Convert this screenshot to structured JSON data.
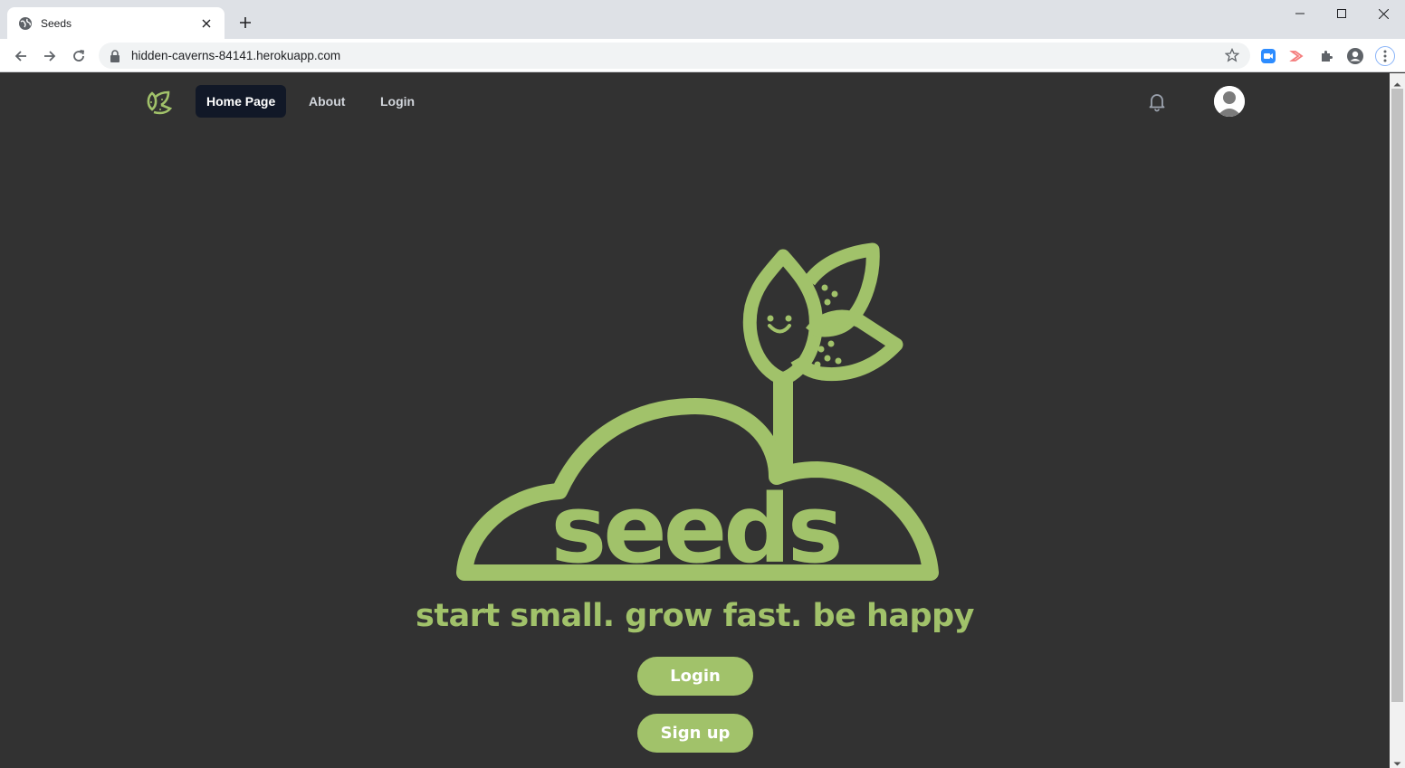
{
  "browser": {
    "tab_title": "Seeds",
    "url": "hidden-caverns-84141.herokuapp.com"
  },
  "nav": {
    "links": [
      {
        "label": "Home Page",
        "active": true
      },
      {
        "label": "About",
        "active": false
      },
      {
        "label": "Login",
        "active": false
      }
    ]
  },
  "hero": {
    "logo_text": "seeds",
    "tagline": "start small. grow fast. be happy",
    "login_label": "Login",
    "signup_label": "Sign up"
  },
  "colors": {
    "accent": "#a1c26a",
    "background": "#323232",
    "nav_active": "#111827"
  }
}
